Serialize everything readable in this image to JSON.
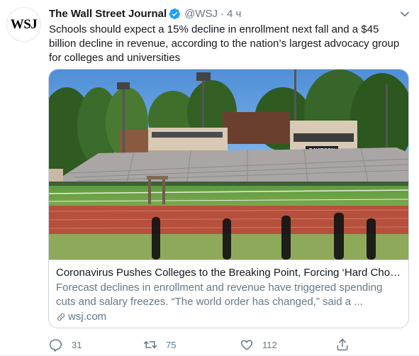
{
  "tweet": {
    "avatar_text": "WSJ",
    "author_name": "The Wall Street Journal",
    "handle": "@WSJ",
    "separator": "·",
    "time": "4 ч",
    "text": "Schools should expect a 15% decline in enrollment next fall and a $45 billion decline in revenue, according to the nation’s largest advocacy group for colleges and universities"
  },
  "card": {
    "image_stadium_label": "DAVIDSON",
    "title": "Coronavirus Pushes Colleges to the Breaking Point, Forcing ‘Hard Choic...",
    "description": "Forecast declines in enrollment and revenue have triggered spending cuts and salary freezes. “The world order has changed,” said a ...",
    "domain": "wsj.com"
  },
  "actions": {
    "reply_count": "31",
    "retweet_count": "75",
    "like_count": "112"
  },
  "colors": {
    "text_primary": "#14171a",
    "text_secondary": "#657786",
    "verified_blue": "#1da1f2",
    "border": "#ccd6dd"
  },
  "icons": [
    "verified-badge-icon",
    "caret-down-icon",
    "link-icon",
    "reply-icon",
    "retweet-icon",
    "like-icon",
    "share-icon"
  ]
}
